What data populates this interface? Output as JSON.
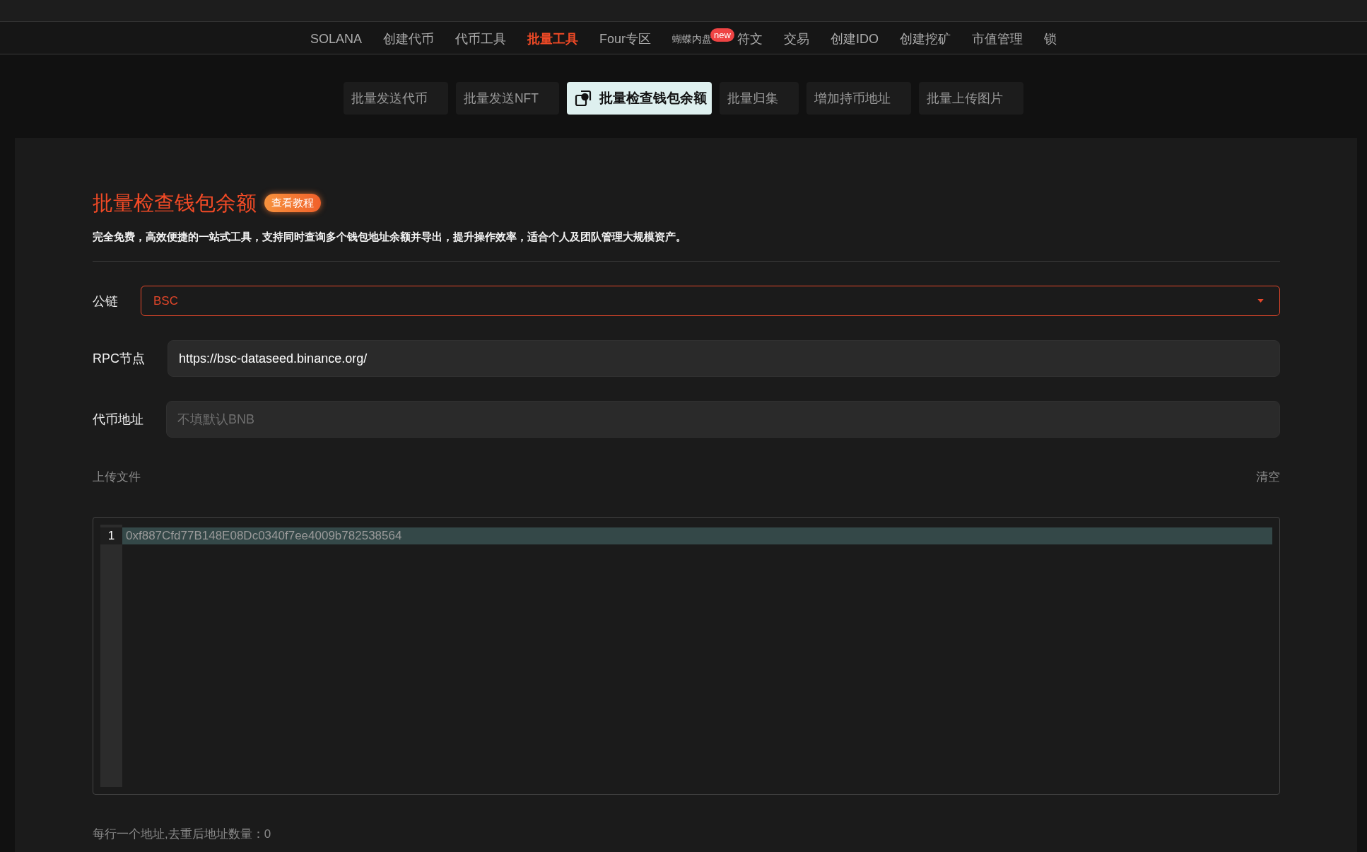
{
  "top_nav": {
    "items": [
      {
        "label": "SOLANA",
        "kind": "link",
        "selected": false
      },
      {
        "label": "创建代币",
        "kind": "link",
        "selected": false
      },
      {
        "label": "代币工具",
        "kind": "link",
        "selected": false
      },
      {
        "label": "批量工具",
        "kind": "link",
        "selected": true
      },
      {
        "label": "Four专区",
        "kind": "link",
        "selected": false
      },
      {
        "label": "蝴蝶内盘",
        "kind": "small",
        "selected": false,
        "badge": "new"
      },
      {
        "label": "符文",
        "kind": "link",
        "selected": false
      },
      {
        "label": "交易",
        "kind": "link",
        "selected": false
      },
      {
        "label": "创建IDO",
        "kind": "link",
        "selected": false
      },
      {
        "label": "创建挖矿",
        "kind": "link",
        "selected": false
      },
      {
        "label": "市值管理",
        "kind": "link",
        "selected": false
      },
      {
        "label": "锁",
        "kind": "link",
        "selected": false
      }
    ]
  },
  "sub_tabs": [
    {
      "label": "批量发送代币",
      "selected": false
    },
    {
      "label": "批量发送NFT",
      "selected": false
    },
    {
      "label": "批量检查钱包余额",
      "selected": true
    },
    {
      "label": "批量归集",
      "selected": false
    },
    {
      "label": "增加持币地址",
      "selected": false
    },
    {
      "label": "批量上传图片",
      "selected": false
    }
  ],
  "panel": {
    "title": "批量检查钱包余额",
    "tutorial_button": "查看教程",
    "description": "完全免费，高效便捷的一站式工具，支持同时查询多个钱包地址余额并导出，提升操作效率，适合个人及团队管理大规模资产。",
    "fields": [
      {
        "kind": "select",
        "label": "公链",
        "value": "BSC",
        "focused": true
      },
      {
        "kind": "input",
        "label": "RPC节点",
        "value": "https://bsc-dataseed.binance.org/"
      },
      {
        "kind": "input",
        "label": "代币地址",
        "placeholder": "不填默认BNB"
      }
    ],
    "upload": {
      "label": "上传文件",
      "clear": "清空"
    },
    "editor": {
      "lines": [
        {
          "number": "1",
          "text": "0xf887Cfd77B148E08Dc0340f7ee4009b782538564",
          "active": true
        }
      ]
    },
    "footer_note": "每行一个地址,去重后地址数量：0"
  }
}
